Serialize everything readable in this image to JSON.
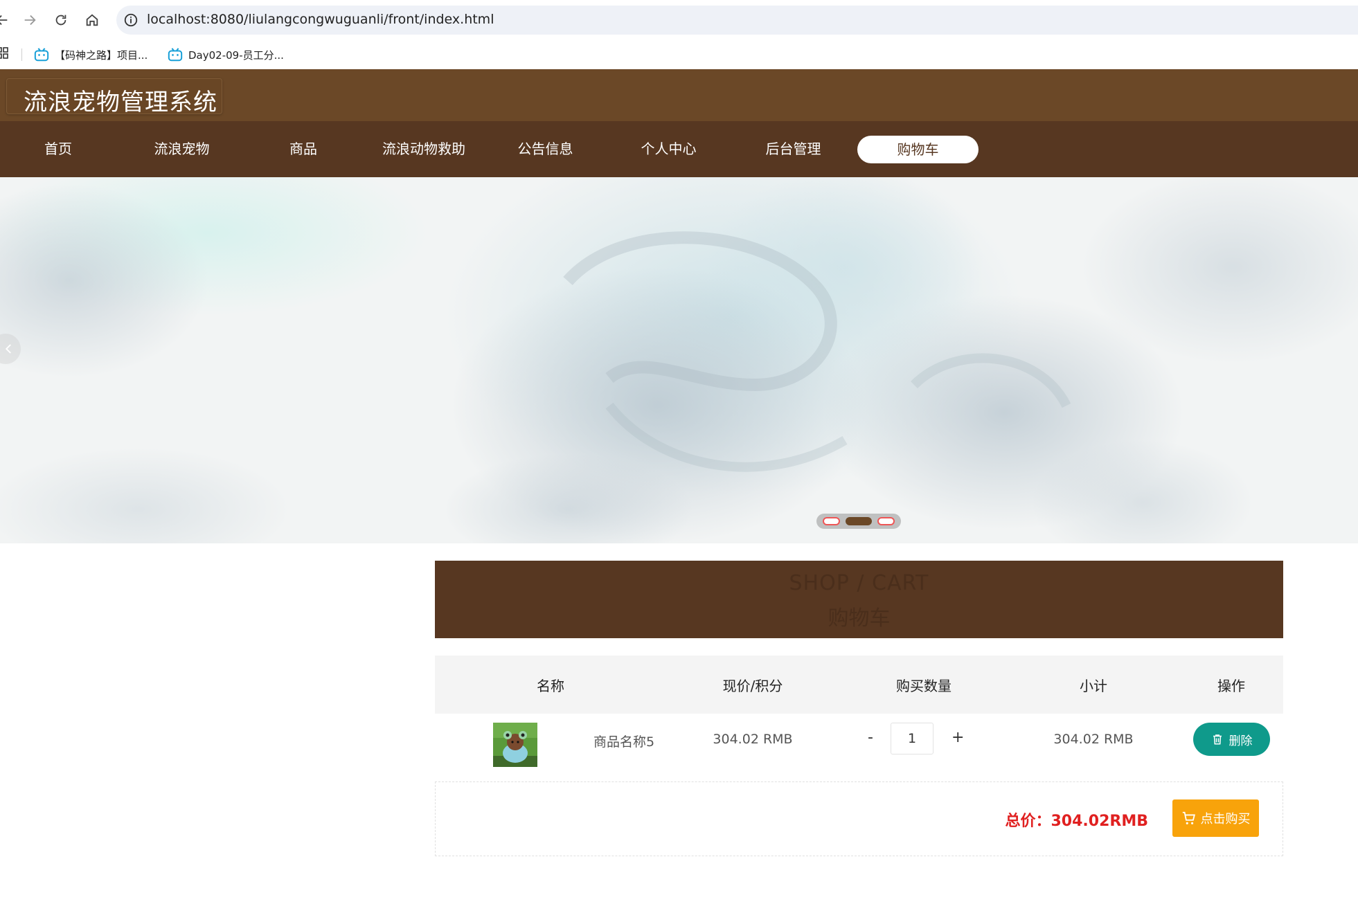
{
  "browser": {
    "url": "localhost:8080/liulangcongwuguanli/front/index.html",
    "bookmarks": [
      "【码神之路】项目...",
      "Day02-09-员工分..."
    ]
  },
  "site": {
    "title": "流浪宠物管理系统",
    "nav": [
      {
        "label": "首页",
        "active": false
      },
      {
        "label": "流浪宠物",
        "active": false
      },
      {
        "label": "商品",
        "active": false
      },
      {
        "label": "流浪动物救助",
        "active": false
      },
      {
        "label": "公告信息",
        "active": false
      },
      {
        "label": "个人中心",
        "active": false
      },
      {
        "label": "后台管理",
        "active": false
      },
      {
        "label": "购物车",
        "active": true
      }
    ]
  },
  "carousel": {
    "slides": 3,
    "active_index": 1
  },
  "cart": {
    "banner_en": "SHOP / CART",
    "banner_zh": "购物车",
    "columns": [
      "名称",
      "现价/积分",
      "购买数量",
      "小计",
      "操作"
    ],
    "items": [
      {
        "name": "商品名称5",
        "price": "304.02 RMB",
        "quantity": "1",
        "subtotal": "304.02 RMB",
        "minus": "-",
        "plus": "+",
        "delete_label": "删除"
      }
    ],
    "total_label": "总价：304.02RMB",
    "buy_label": "点击购买"
  },
  "colors": {
    "header_bg": "#6b4827",
    "nav_bg": "#573721",
    "delete_btn": "#0f9a8b",
    "buy_btn": "#f8a30b",
    "total_text": "#e02020"
  },
  "icons": [
    "back-arrow-icon",
    "forward-arrow-icon",
    "reload-icon",
    "home-icon",
    "info-icon",
    "apps-grid-icon",
    "bilibili-icon",
    "chevron-left-icon",
    "trash-icon",
    "cart-icon"
  ]
}
